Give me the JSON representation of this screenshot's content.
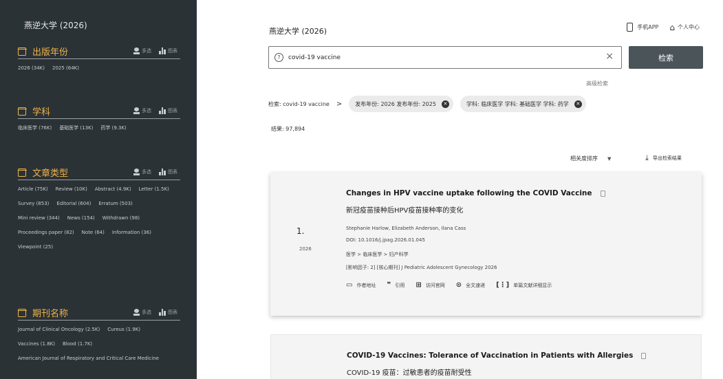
{
  "sidebar": {
    "title": "燕逆大学 (2026)",
    "tool_multi": "多选",
    "tool_chart": "图表",
    "sections": [
      {
        "label": "出版年份",
        "items": [
          "2026 (34K)",
          "2025 (64K)"
        ]
      },
      {
        "label": "学科",
        "items": [
          "临床医学 (76K)",
          "基础医学 (13K)",
          "药学 (9.3K)"
        ]
      },
      {
        "label": "文章类型",
        "items": [
          "Article (75K)",
          "Review (10K)",
          "Abstract (4.9K)",
          "Letter (1.5K)",
          "Survey (853)",
          "Editorial (604)",
          "Erratum (503)",
          "Mini review (344)",
          "News (154)",
          "Withdrawn (98)",
          "Proceedings paper (82)",
          "Note (64)",
          "Information (36)",
          "Viewpoint (25)"
        ]
      },
      {
        "label": "期刊名称",
        "items": [
          "Journal of Clinical Oncology (2.5K)",
          "Cureus (1.9K)",
          "Vaccines (1.8K)",
          "Blood (1.7K)",
          "American Journal of Respiratory and Critical Care Medicine"
        ]
      }
    ]
  },
  "header": {
    "title": "燕逆大学 (2026)",
    "app_label": "手机APP",
    "profile_label": "个人中心"
  },
  "search": {
    "value": "covid-19 vaccine",
    "button_label": "检索",
    "advanced_label": "高级检索"
  },
  "filters": {
    "prefix": "检索: covid-19 vaccine",
    "arrow": ">",
    "chips": [
      "发布年份: 2026 发布年份: 2025",
      "学科: 临床医学 学科: 基础医学 学科: 药学"
    ]
  },
  "results": {
    "count_text": "结果: 97,894",
    "sort_label": "相关度排序",
    "export_label": "导出检索结果"
  },
  "articles": [
    {
      "rank": "1.",
      "year": "2026",
      "title_en": "Changes in HPV vaccine uptake following the COVID Vaccine",
      "title_zh": "新冠疫苗接种后HPV疫苗接种率的变化",
      "authors": "Stephanie Harlow, Elizabeth Anderson, Ilana Cass",
      "doi": "DOI: 10.1016/j.jpag.2026.01.045",
      "subject": "医学 > 临床医学 > 妇产科学",
      "metrics": "[影响因子: 2]  [核心期刊]  J Pediatric Adolescent Gynecology 2026",
      "actions": [
        "作者地址",
        "引用",
        "访问官网",
        "全文速递",
        "单篇文献详细显示"
      ]
    },
    {
      "title_en": "COVID-19 Vaccines: Tolerance of Vaccination in Patients with Allergies",
      "title_zh": "COVID-19 疫苗：过敏患者的疫苗耐受性"
    }
  ]
}
